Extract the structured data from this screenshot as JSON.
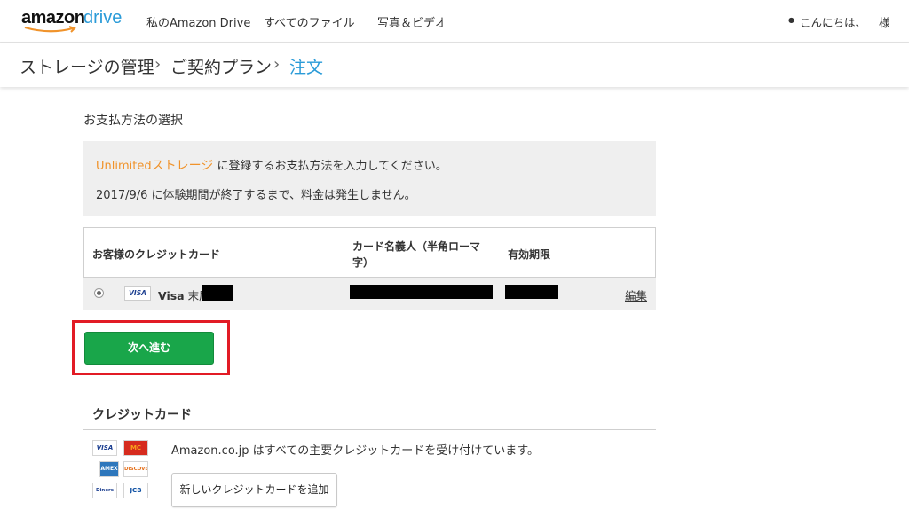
{
  "colors": {
    "accent": "#2a9bd8",
    "orange": "#f0932b",
    "green": "#19a64a",
    "highlight": "#e21b25"
  },
  "header": {
    "logo_amazon": "amazon",
    "logo_drive": "drive",
    "nav": [
      "私のAmazon Drive",
      "すべてのファイル",
      "写真＆ビデオ"
    ],
    "greeting": "こんにちは、",
    "greeting_suffix": "様"
  },
  "breadcrumb": [
    "ストレージの管理",
    "ご契約プラン",
    "注文"
  ],
  "breadcrumb_sep": "›",
  "payment": {
    "section_title": "お支払方法の選択",
    "notice_plan": "Unlimited",
    "notice_plan_storage": "ストレージ",
    "notice_line1_rest": " に登録するお支払方法を入力してください。",
    "notice_line2": "2017/9/6 に体験期間が終了するまで、料金は発生しません。",
    "table_headers": [
      "お客様のクレジットカード",
      "カード名義人（半角ローマ字）",
      "有効期限"
    ],
    "card": {
      "brand_badge": "VISA",
      "brand": "Visa",
      "suffix_label": "末尾",
      "edit": "編集"
    },
    "next_button": "次へ進む"
  },
  "credit": {
    "title": "クレジットカード",
    "logos": [
      "VISA",
      "MC",
      "AMEX",
      "DISCOVER",
      "Diners",
      "JCB"
    ],
    "accepted_text": "Amazon.co.jp はすべての主要クレジットカードを受け付けています。",
    "add_button": "新しいクレジットカードを追加"
  }
}
